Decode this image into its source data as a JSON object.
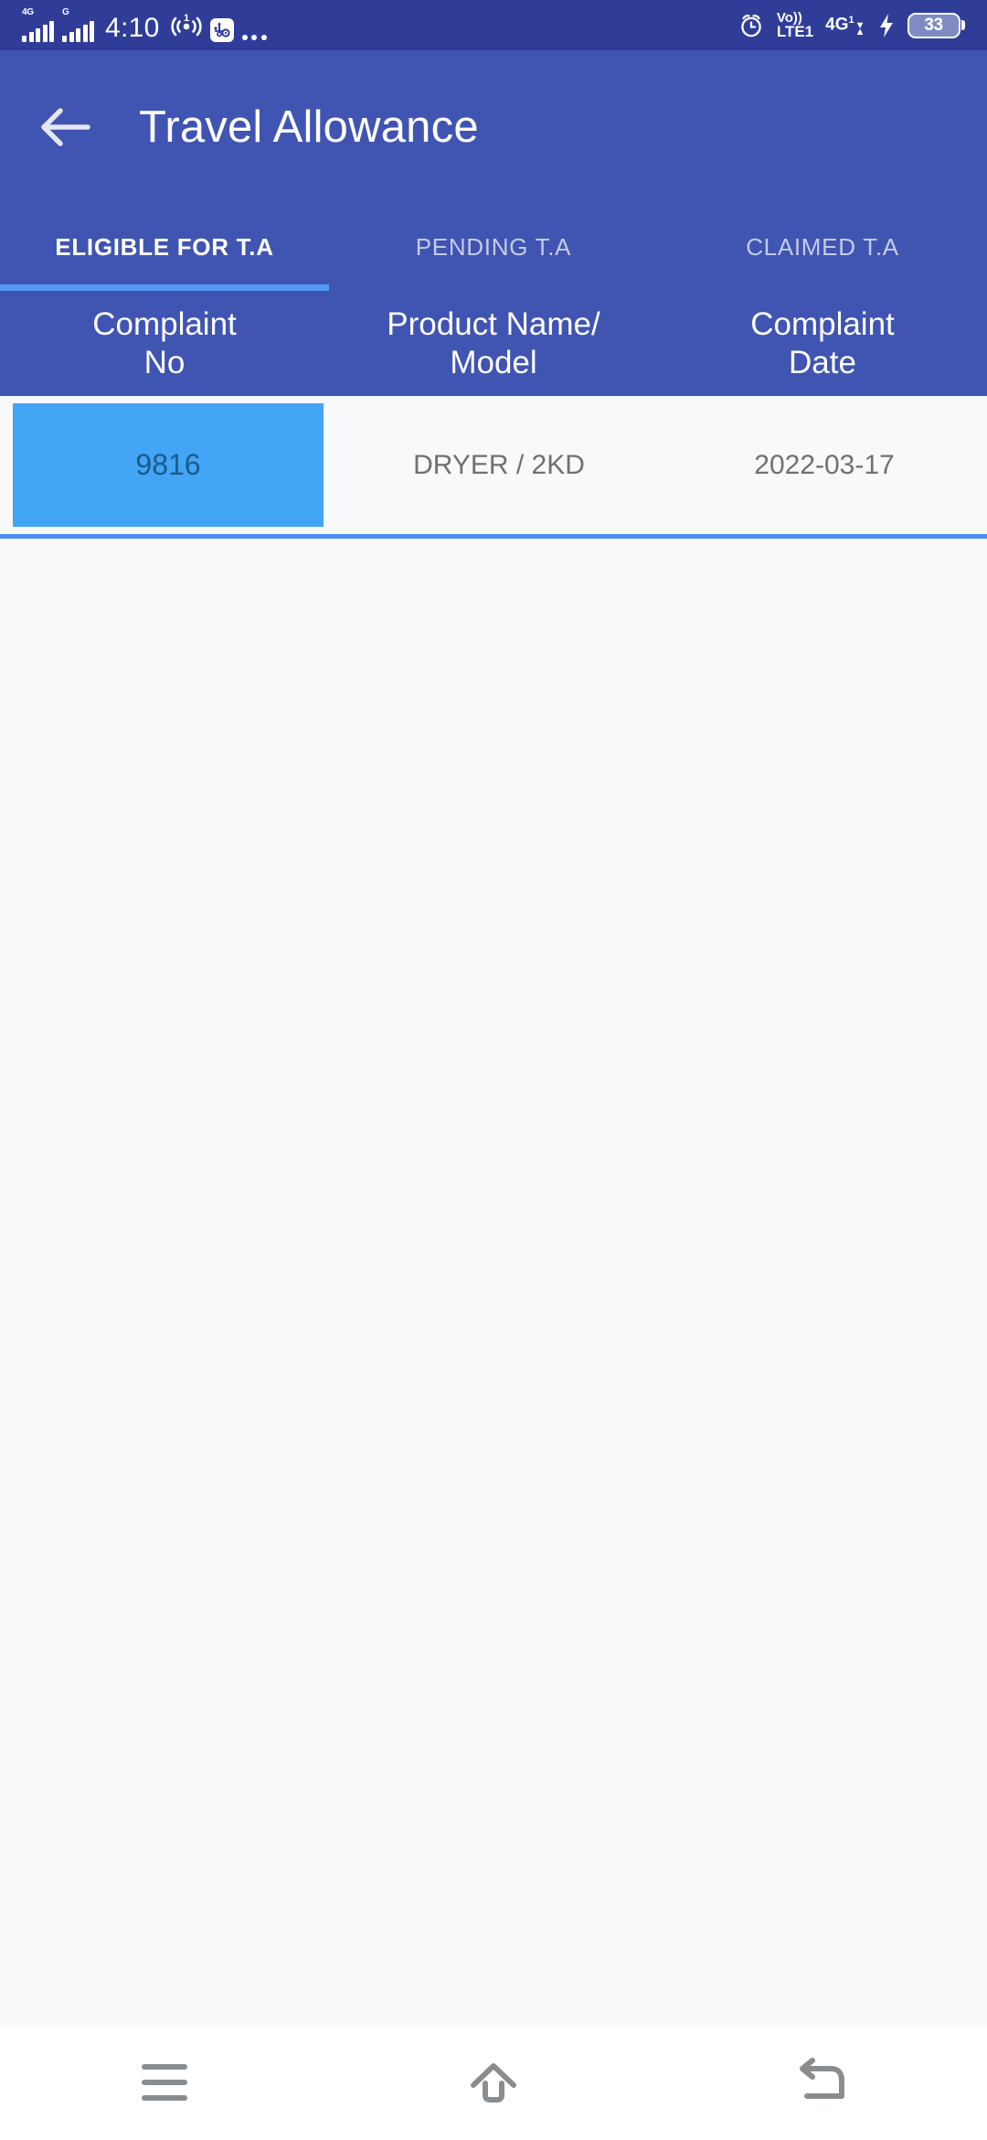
{
  "statusbar": {
    "network_primary": "4G",
    "network_secondary": "G",
    "time": "4:10",
    "hotspot_count": "1",
    "hotspot_icon": "hotspot-icon",
    "usb_icon": "usb-settings-icon",
    "overflow_icon": "overflow-dots-icon",
    "alarm_icon": "alarm-clock-icon",
    "volte_top": "Vo))",
    "volte_bottom": "LTE1",
    "data_network": "4G",
    "data_network_sup": "1",
    "charging_icon": "charging-bolt-icon",
    "battery_level": "33"
  },
  "appbar": {
    "back_icon": "back-arrow-icon",
    "title": "Travel Allowance"
  },
  "tabs": {
    "items": [
      {
        "label": "ELIGIBLE FOR T.A",
        "active": true
      },
      {
        "label": "PENDING T.A",
        "active": false
      },
      {
        "label": "CLAIMED T.A",
        "active": false
      }
    ],
    "indicator_color": "#539bf5"
  },
  "table": {
    "columns": [
      "Complaint\nNo",
      "Product Name/\nModel",
      "Complaint\nDate"
    ],
    "columns_display": [
      {
        "line1": "Complaint",
        "line2": "No"
      },
      {
        "line1": "Product Name/",
        "line2": "Model"
      },
      {
        "line1": "Complaint",
        "line2": "Date"
      }
    ],
    "rows": [
      {
        "complaint_no": "9816",
        "product_name_model": "DRYER / 2KD",
        "complaint_date": "2022-03-17",
        "complaint_no_highlighted": true
      }
    ],
    "header_bg": "#4054b2",
    "row_divider_color": "#4a8ef0",
    "highlight_color": "#42a5f5"
  },
  "navbar": {
    "recents_icon": "menu-lines-icon",
    "home_icon": "home-icon",
    "back_icon": "back-curved-arrow-icon"
  },
  "theme": {
    "statusbar_bg": "#2f3d99",
    "appbar_bg": "#4054b2",
    "content_bg": "#f8f9fa",
    "navbar_bg": "#ffffff"
  }
}
